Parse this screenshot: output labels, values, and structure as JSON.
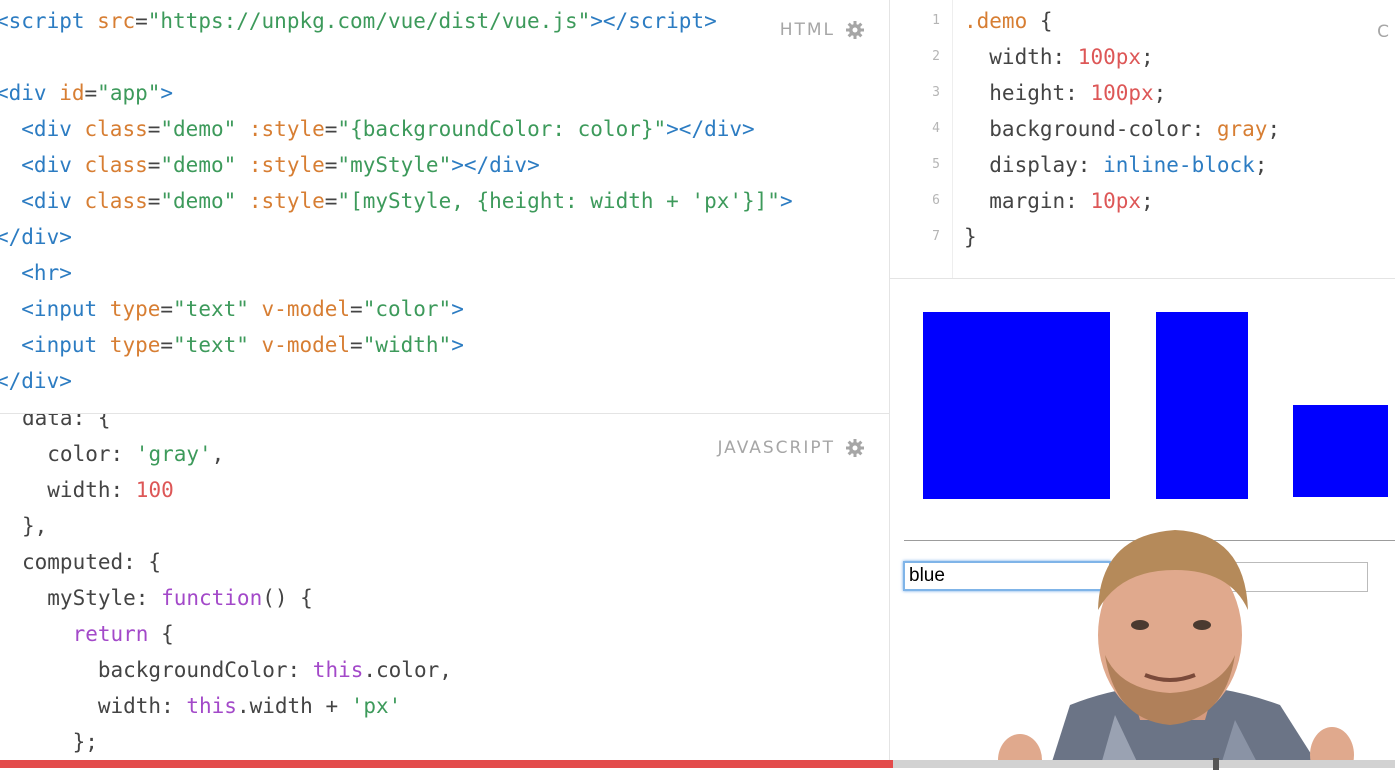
{
  "html_pane": {
    "label": "HTML",
    "lines": [
      [
        "<",
        "t-tag"
      ],
      [
        "",
        "t-tag"
      ]
    ]
  },
  "html_code": [
    [
      [
        "<script ",
        "t-tag"
      ],
      [
        "src",
        "t-attr"
      ],
      [
        "=",
        "t-txt"
      ],
      [
        "\"https://unpkg.com/vue/dist/vue.js\"",
        "t-str"
      ],
      [
        "></",
        "t-tag"
      ],
      [
        "script",
        "t-tag"
      ],
      [
        ">",
        "t-tag"
      ]
    ],
    [],
    [
      [
        "<div ",
        "t-tag"
      ],
      [
        "id",
        "t-attr"
      ],
      [
        "=",
        "t-txt"
      ],
      [
        "\"app\"",
        "t-str"
      ],
      [
        ">",
        "t-tag"
      ]
    ],
    [
      [
        "  <div ",
        "t-tag"
      ],
      [
        "class",
        "t-attr"
      ],
      [
        "=",
        "t-txt"
      ],
      [
        "\"demo\"",
        "t-str"
      ],
      [
        " :style",
        "t-attr"
      ],
      [
        "=",
        "t-txt"
      ],
      [
        "\"{backgroundColor: color}\"",
        "t-str"
      ],
      [
        "></div>",
        "t-tag"
      ]
    ],
    [
      [
        "  <div ",
        "t-tag"
      ],
      [
        "class",
        "t-attr"
      ],
      [
        "=",
        "t-txt"
      ],
      [
        "\"demo\"",
        "t-str"
      ],
      [
        " :style",
        "t-attr"
      ],
      [
        "=",
        "t-txt"
      ],
      [
        "\"myStyle\"",
        "t-str"
      ],
      [
        "></div>",
        "t-tag"
      ]
    ],
    [
      [
        "  <div ",
        "t-tag"
      ],
      [
        "class",
        "t-attr"
      ],
      [
        "=",
        "t-txt"
      ],
      [
        "\"demo\"",
        "t-str"
      ],
      [
        " :style",
        "t-attr"
      ],
      [
        "=",
        "t-txt"
      ],
      [
        "\"[myStyle, {height: width + 'px'}]\"",
        "t-str"
      ],
      [
        ">",
        "t-tag"
      ]
    ],
    [
      [
        "</div>",
        "t-tag"
      ]
    ],
    [
      [
        "  <hr>",
        "t-tag"
      ]
    ],
    [
      [
        "  <input ",
        "t-tag"
      ],
      [
        "type",
        "t-attr"
      ],
      [
        "=",
        "t-txt"
      ],
      [
        "\"text\"",
        "t-str"
      ],
      [
        " v-model",
        "t-attr"
      ],
      [
        "=",
        "t-txt"
      ],
      [
        "\"color\"",
        "t-str"
      ],
      [
        ">",
        "t-tag"
      ]
    ],
    [
      [
        "  <input ",
        "t-tag"
      ],
      [
        "type",
        "t-attr"
      ],
      [
        "=",
        "t-txt"
      ],
      [
        "\"text\"",
        "t-str"
      ],
      [
        " v-model",
        "t-attr"
      ],
      [
        "=",
        "t-txt"
      ],
      [
        "\"width\"",
        "t-str"
      ],
      [
        ">",
        "t-tag"
      ]
    ],
    [
      [
        "</div>",
        "t-tag"
      ]
    ]
  ],
  "js_pane": {
    "label": "JAVASCRIPT"
  },
  "js_code": [
    [
      [
        "data: {",
        "t-txt"
      ]
    ],
    [
      [
        "  color: ",
        "t-txt"
      ],
      [
        "'gray'",
        "t-str"
      ],
      [
        ",",
        "t-txt"
      ]
    ],
    [
      [
        "  width: ",
        "t-txt"
      ],
      [
        "100",
        "t-num"
      ]
    ],
    [
      [
        "},",
        "t-txt"
      ]
    ],
    [
      [
        "computed: {",
        "t-txt"
      ]
    ],
    [
      [
        "  myStyle: ",
        "t-txt"
      ],
      [
        "function",
        "t-kw"
      ],
      [
        "() {",
        "t-txt"
      ]
    ],
    [
      [
        "    ",
        "t-txt"
      ],
      [
        "return",
        "t-kw"
      ],
      [
        " {",
        "t-txt"
      ]
    ],
    [
      [
        "      backgroundColor: ",
        "t-txt"
      ],
      [
        "this",
        "t-kw"
      ],
      [
        ".color,",
        "t-txt"
      ]
    ],
    [
      [
        "      width: ",
        "t-txt"
      ],
      [
        "this",
        "t-kw"
      ],
      [
        ".width + ",
        "t-txt"
      ],
      [
        "'px'",
        "t-str"
      ]
    ],
    [
      [
        "    };",
        "t-txt"
      ]
    ]
  ],
  "css_pane": {
    "label": "C"
  },
  "css_line_numbers": [
    "1",
    "2",
    "3",
    "4",
    "5",
    "6",
    "7"
  ],
  "css_code": [
    [
      [
        ".demo",
        "t-attr"
      ],
      [
        " {",
        "t-txt"
      ]
    ],
    [
      [
        "  width: ",
        "t-txt"
      ],
      [
        "100px",
        "t-num"
      ],
      [
        ";",
        "t-txt"
      ]
    ],
    [
      [
        "  height: ",
        "t-txt"
      ],
      [
        "100px",
        "t-num"
      ],
      [
        ";",
        "t-txt"
      ]
    ],
    [
      [
        "  background-color: ",
        "t-txt"
      ],
      [
        "gray",
        "t-attr"
      ],
      [
        ";",
        "t-txt"
      ]
    ],
    [
      [
        "  display: ",
        "t-txt"
      ],
      [
        "inline-block",
        "t-tag"
      ],
      [
        ";",
        "t-txt"
      ]
    ],
    [
      [
        "  margin: ",
        "t-txt"
      ],
      [
        "10px",
        "t-num"
      ],
      [
        ";",
        "t-txt"
      ]
    ],
    [
      [
        "}",
        "t-txt"
      ]
    ]
  ],
  "result": {
    "box_color": "#0000ff",
    "color_input_value": "blue",
    "width_input_value": ""
  },
  "video": {
    "progress_fraction": 0.64
  }
}
